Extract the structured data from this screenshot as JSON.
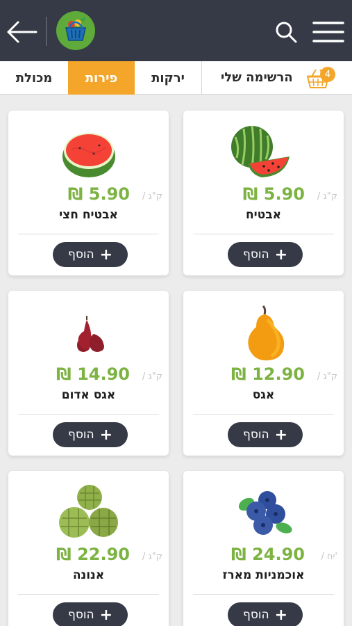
{
  "header": {
    "back_icon": "arrow-left-icon",
    "logo_icon": "basket-logo-icon",
    "search_icon": "search-icon",
    "menu_icon": "hamburger-menu-icon"
  },
  "tabs": {
    "dairy": "מכולת",
    "fruits": "פירות",
    "vegetables": "ירקות",
    "my_list": "הרשימה שלי",
    "my_list_count": "4"
  },
  "colors": {
    "header_bg": "#353a46",
    "accent": "#f4a62a",
    "price": "#7cb342"
  },
  "products": [
    {
      "name": "אבטיח",
      "price": "₪ 5.90",
      "unit": "/ ק\"ג",
      "add_label": "הוסף",
      "image": "watermelon-image"
    },
    {
      "name": "אבטיח חצי",
      "price": "₪ 5.90",
      "unit": "/ ק\"ג",
      "add_label": "הוסף",
      "image": "half-watermelon-image"
    },
    {
      "name": "אגס",
      "price": "₪ 12.90",
      "unit": "/ ק\"ג",
      "add_label": "הוסף",
      "image": "pear-image"
    },
    {
      "name": "אגס אדום",
      "price": "₪ 14.90",
      "unit": "/ ק\"ג",
      "add_label": "הוסף",
      "image": "red-pear-image"
    },
    {
      "name": "אוכמניות מארז",
      "price": "₪ 24.90",
      "unit": "/ יח'",
      "add_label": "הוסף",
      "image": "blueberries-image"
    },
    {
      "name": "אנונה",
      "price": "₪ 22.90",
      "unit": "/ ק\"ג",
      "add_label": "הוסף",
      "image": "annona-image"
    }
  ]
}
